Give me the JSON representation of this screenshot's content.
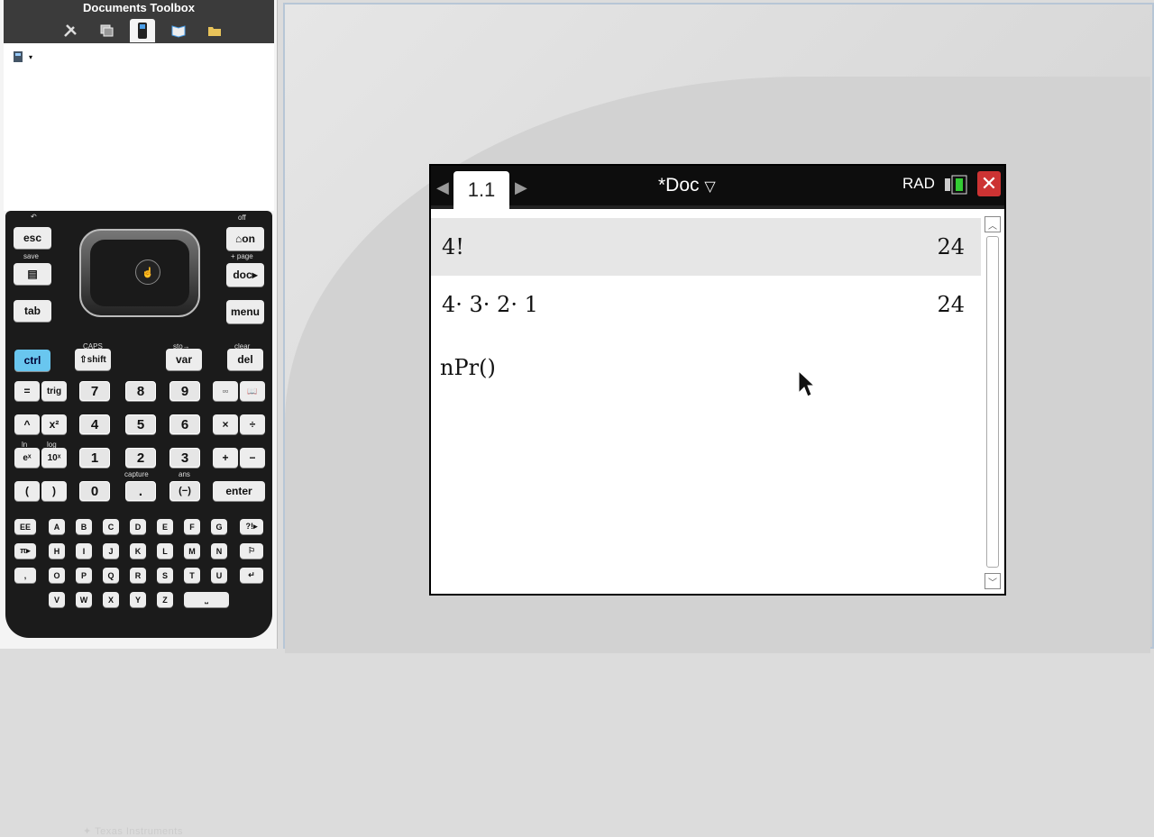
{
  "toolbox": {
    "title": "Documents Toolbox",
    "tabs": [
      {
        "name": "tools-icon"
      },
      {
        "name": "page-sorter-icon"
      },
      {
        "name": "keypad-icon"
      },
      {
        "name": "content-explorer-icon"
      },
      {
        "name": "folder-icon"
      }
    ]
  },
  "calculator": {
    "esc": "esc",
    "tab": "tab",
    "on": "on",
    "doc": "doc",
    "menu": "menu",
    "ctrl": "ctrl",
    "shift": "shift",
    "var": "var",
    "del": "del",
    "caps": "CAPS",
    "sto": "sto→",
    "clear": "clear",
    "save": "save",
    "off": "off",
    "page": "+ page",
    "capture": "capture",
    "ans": "ans",
    "ln": "ln",
    "log": "log",
    "eq": "=",
    "trig": "trig",
    "pow": "^",
    "sq": "x²",
    "ex": "eˣ",
    "tenx": "10ˣ",
    "lp": "(",
    "rp": ")",
    "neg": "(−)",
    "enter": "enter",
    "dot": ".",
    "mul": "×",
    "div": "÷",
    "plus": "+",
    "minus": "−",
    "digits": [
      "7",
      "8",
      "9",
      "4",
      "5",
      "6",
      "1",
      "2",
      "3",
      "0"
    ],
    "letters_row1": [
      "EE",
      "A",
      "B",
      "C",
      "D",
      "E",
      "F",
      "G",
      "?!▸"
    ],
    "letters_row2": [
      "π▸",
      "H",
      "I",
      "J",
      "K",
      "L",
      "M",
      "N",
      "⚐"
    ],
    "letters_row3": [
      ",",
      "O",
      "P",
      "Q",
      "R",
      "S",
      "T",
      "U",
      "↵"
    ],
    "letters_row4": [
      "V",
      "W",
      "X",
      "Y",
      "Z",
      "⎵"
    ],
    "brand": "Texas Instruments"
  },
  "screen": {
    "page_tab": "1.1",
    "doc_title": "*Doc",
    "angle_mode": "RAD",
    "history": [
      {
        "expr": "4!",
        "result": "24"
      },
      {
        "expr": "4· 3· 2· 1",
        "result": "24"
      }
    ],
    "input": "nPr()"
  }
}
